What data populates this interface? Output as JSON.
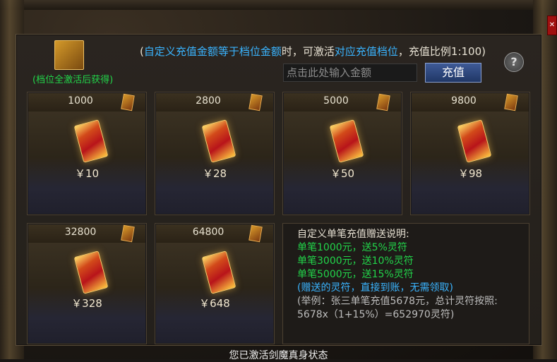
{
  "header": {
    "prefix": "(",
    "part1": "自定义充值金额等于档位金额",
    "part2": "时，可激活",
    "part3": "对应充值档位",
    "part4": "，充值比例1:100)"
  },
  "help_label": "?",
  "token_label": "(档位全激活后获得)",
  "input": {
    "placeholder": "点击此处输入金额",
    "value": ""
  },
  "recharge_label": "充值",
  "tiers": [
    {
      "amount": "1000",
      "price": "￥10"
    },
    {
      "amount": "2800",
      "price": "￥28"
    },
    {
      "amount": "5000",
      "price": "￥50"
    },
    {
      "amount": "9800",
      "price": "￥98"
    },
    {
      "amount": "32800",
      "price": "￥328"
    },
    {
      "amount": "64800",
      "price": "￥648"
    }
  ],
  "info": {
    "title": "自定义单笔充值赠送说明:",
    "lines": [
      "单笔1000元，送5%灵符",
      "单笔3000元，送10%灵符",
      "单笔5000元，送15%灵符"
    ],
    "note": "(赠送的灵符，直接到账，无需领取)",
    "example1": "(举例：张三单笔充值5678元，总计灵符按照:",
    "example2": "5678x（1+15%）=652970灵符)"
  },
  "status_text": "您已激活剑魔真身状态",
  "colors": {
    "green": "#22d44a",
    "blue": "#3ab4ff",
    "gold": "#d89a2a"
  }
}
